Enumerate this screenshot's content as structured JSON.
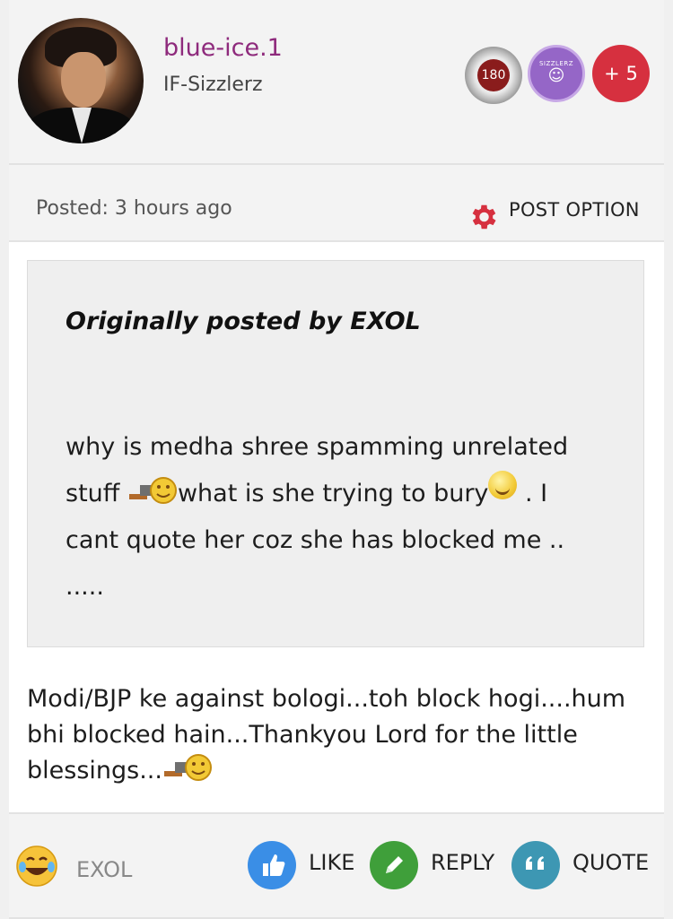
{
  "user": {
    "name": "blue-ice.1",
    "group": "IF-Sizzlerz",
    "badges": {
      "level": "180",
      "sizzlerz": "SIZZLERZ",
      "more": "+ 5"
    }
  },
  "post": {
    "posted": "Posted: 3 hours ago",
    "option_label": "POST OPTION",
    "quote_header": "Originally posted by EXOL",
    "quote_text_1": "why is medha shree spamming unrelated stuff ",
    "quote_text_2": "what is she  trying to bury",
    "quote_text_3": " . I cant quote her coz she has blocked  me .. .....",
    "reply_text": "Modi/BJP ke against bologi...toh block hogi....hum bhi blocked hain...Thankyou Lord for the little blessings..."
  },
  "footer": {
    "reactor": "EXOL",
    "like": "LIKE",
    "reply": "REPLY",
    "quote": "QUOTE"
  },
  "colors": {
    "username": "#8e2a7c",
    "accent_red": "#d6303f",
    "like_blue": "#3a8ee6",
    "reply_green": "#3f9f3a",
    "quote_teal": "#3d97b3"
  }
}
